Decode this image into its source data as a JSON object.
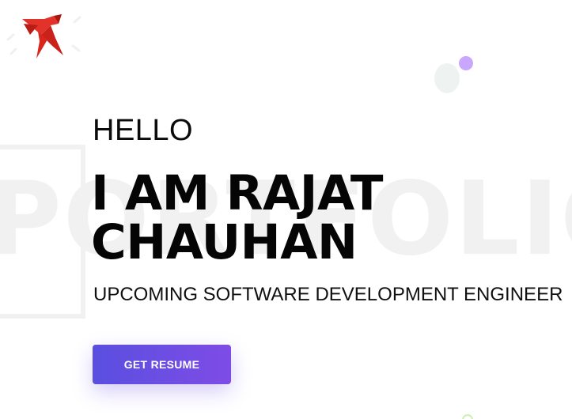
{
  "logo": {
    "icon": "phoenix-logo-icon",
    "color": "#d8261d"
  },
  "watermark": {
    "text": "PORTFOLIO",
    "color": "#f1f1f1"
  },
  "hero": {
    "greeting": "HELLO",
    "name_line1": "I AM RAJAT",
    "name_line2": "CHAUHAN",
    "tagline": "UPCOMING SOFTWARE DEVELOPMENT ENGINEER"
  },
  "actions": {
    "resume_label": "GET RESUME"
  },
  "colors": {
    "button_start": "#5a4fe0",
    "button_end": "#7e4ce6",
    "accent_purple": "#c9a7ff"
  }
}
